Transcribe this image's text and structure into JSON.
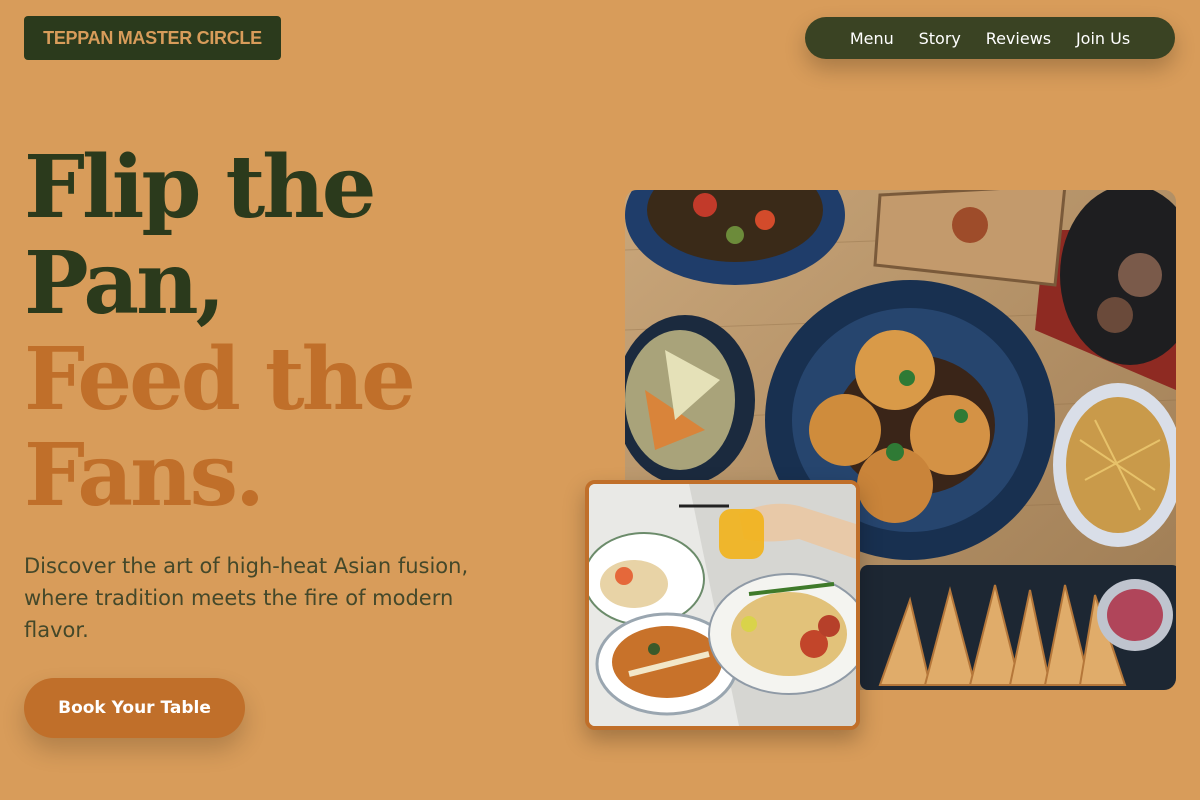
{
  "brand": {
    "name": "TEPPAN MASTER CIRCLE"
  },
  "nav": {
    "items": [
      "Menu",
      "Story",
      "Reviews",
      "Join Us"
    ]
  },
  "hero": {
    "headline_lines": [
      "Flip the",
      "Pan,",
      "Feed the",
      "Fans."
    ],
    "tagline": "Discover the art of high-heat Asian fusion, where tradition meets the fire of modern flavor.",
    "cta_label": "Book Your Table"
  },
  "colors": {
    "background": "#d89c5a",
    "dark_green": "#2b3a1c",
    "accent": "#c06f2a",
    "nav_bg": "#3a4323"
  },
  "images": [
    {
      "role": "main-food-photo",
      "subject": "asian-fusion-dishes-on-table"
    },
    {
      "role": "secondary-food-photo",
      "subject": "sauce-being-poured-over-dishes"
    }
  ]
}
